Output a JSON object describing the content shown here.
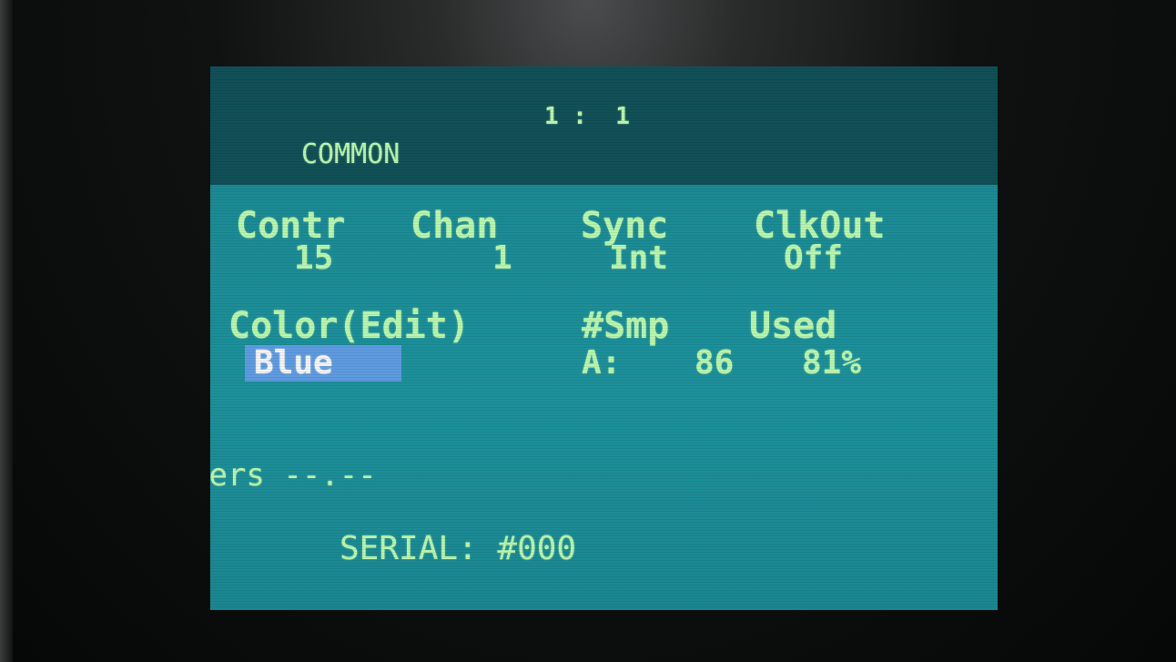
{
  "header": {
    "position": "1 :  1",
    "page_title": "COMMON"
  },
  "params_row1": {
    "labels": [
      "Contr",
      "Chan",
      "Sync",
      "ClkOut"
    ],
    "values": [
      "15",
      "1",
      "Int",
      "Off"
    ]
  },
  "params_row2": {
    "color_label": "Color(Edit)",
    "smp_label": "#Smp",
    "used_label": "Used",
    "color_value": "Blue",
    "smp_bank": "A:",
    "smp_count": "86",
    "used_value": "81%"
  },
  "footer": {
    "version": "Vers --.--",
    "serial": "SERIAL: #000"
  },
  "colors": {
    "screen_bg": "#1b8c96",
    "header_bg": "#115057",
    "text": "#b9f5ae",
    "selection": "#5e9be0"
  }
}
